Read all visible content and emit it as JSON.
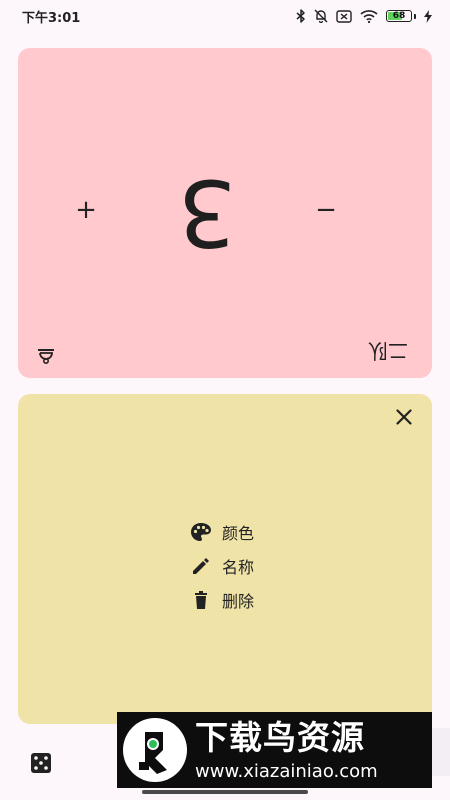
{
  "status_bar": {
    "time": "下午3:01",
    "battery_percent": "68",
    "battery_level": 0.68,
    "icons": [
      "bluetooth-icon",
      "mute-bell-icon",
      "no-sim-icon",
      "wifi-icon",
      "battery-icon",
      "charging-bolt-icon"
    ]
  },
  "counter": {
    "value": "3",
    "name": "二队",
    "increment_label": "+",
    "decrement_label": "−",
    "background_color": "#ffc9ce",
    "corner_icon": "rotate-icon"
  },
  "menu": {
    "background_color": "#f0e3a7",
    "items": [
      {
        "icon": "palette-icon",
        "label": "颜色"
      },
      {
        "icon": "pencil-icon",
        "label": "名称"
      },
      {
        "icon": "trash-icon",
        "label": "删除"
      }
    ],
    "close_icon": "close-icon"
  },
  "bottom_bar": {
    "dice_icon": "dice-icon"
  },
  "watermark": {
    "title": "下载鸟资源",
    "url": "www.xiazainiao.com"
  }
}
